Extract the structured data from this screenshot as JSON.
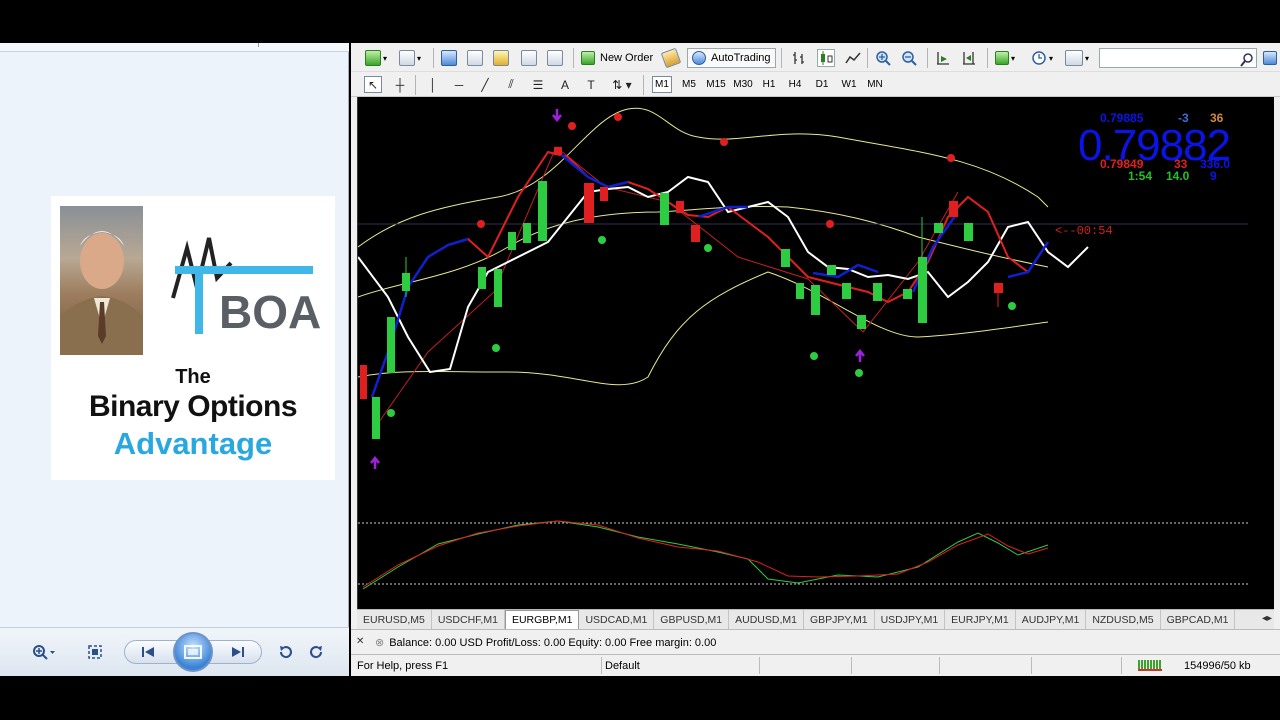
{
  "viewer": {
    "brand_the": "The",
    "brand_main": "Binary Options",
    "brand_advantage": "Advantage",
    "logo_text": "BOA",
    "colors": {
      "brand_blue": "#29a8e0",
      "logo_blue": "#3fb7e8"
    },
    "toolbar_icons": [
      "zoom-icon",
      "fit-window-icon",
      "previous-icon",
      "slideshow-icon",
      "next-icon",
      "rotate-left-icon",
      "rotate-right-icon"
    ]
  },
  "toolbar": {
    "new_order_label": "New Order",
    "autotrading_label": "AutoTrading",
    "search_placeholder": "",
    "timeframes": [
      "M1",
      "M5",
      "M15",
      "M30",
      "H1",
      "H4",
      "D1",
      "W1",
      "MN"
    ],
    "active_timeframe": "M1"
  },
  "quote": {
    "bid": "0.79885",
    "spread_change": "-3",
    "ticks": "36",
    "big_price": "0.79882",
    "ask": "0.79849",
    "val2": "33",
    "val3": "336.0",
    "time": "1:54",
    "val4": "14.0",
    "val5": "9",
    "countdown": "<--00:54",
    "colors": {
      "blue": "#0a14e6",
      "red": "#e02020",
      "green": "#25c025",
      "orange": "#d08a3a"
    }
  },
  "tabs": [
    "EURUSD,M5",
    "USDCHF,M1",
    "EURGBP,M1",
    "USDCAD,M1",
    "GBPUSD,M1",
    "AUDUSD,M1",
    "GBPJPY,M1",
    "USDJPY,M1",
    "EURJPY,M1",
    "AUDJPY,M1",
    "NZDUSD,M5",
    "GBPCAD,M1"
  ],
  "active_tab": "EURGBP,M1",
  "terminal": {
    "balance_line": "Balance: 0.00 USD  Profit/Loss: 0.00  Equity: 0.00  Free margin: 0.00"
  },
  "status": {
    "help": "For Help, press F1",
    "profile": "Default",
    "traffic": "154996/50 kb"
  }
}
